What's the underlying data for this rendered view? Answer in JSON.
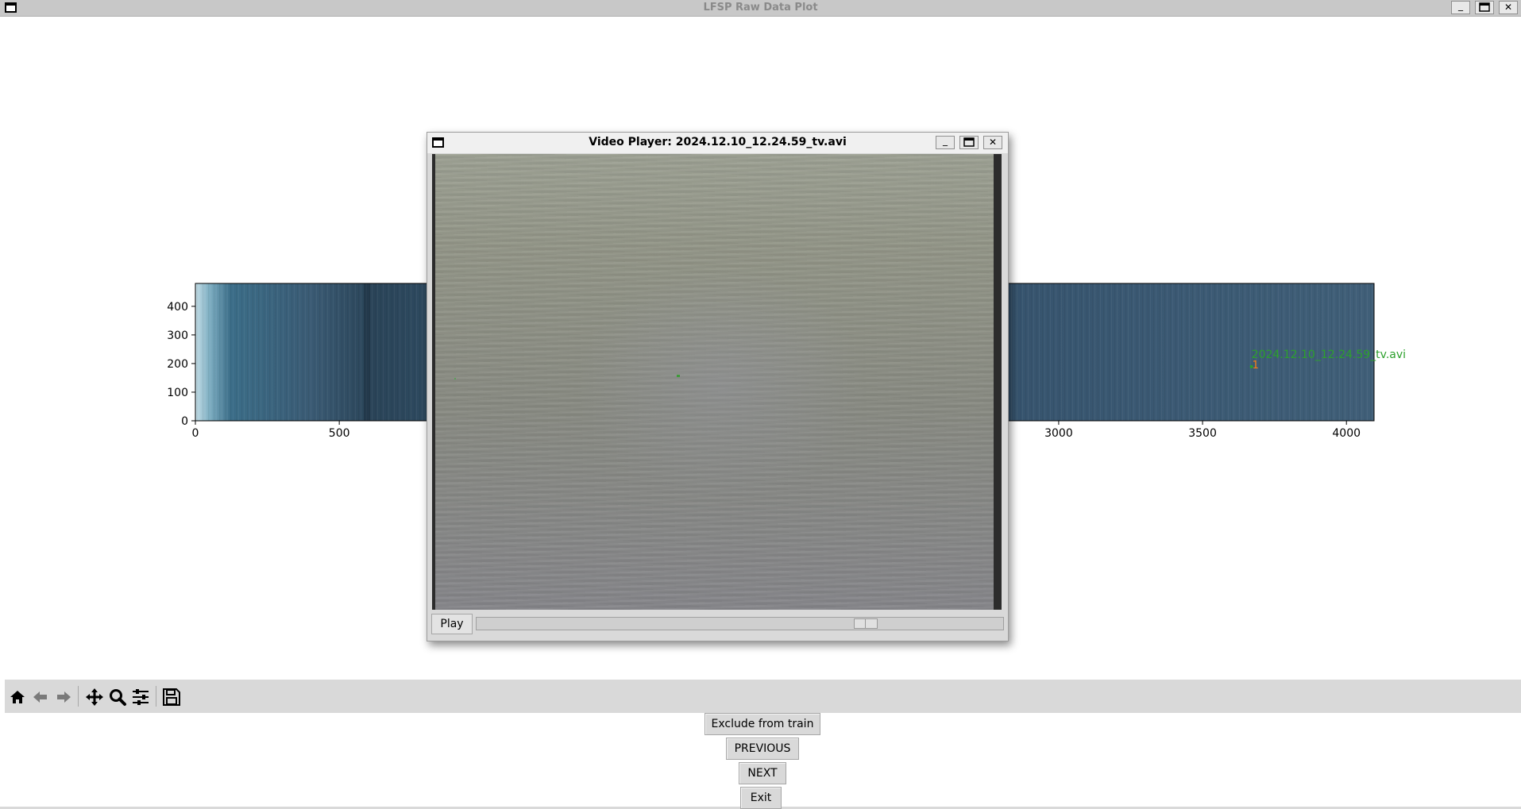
{
  "main_window": {
    "title": "LFSP Raw Data Plot",
    "minimize": "_",
    "close": "✕"
  },
  "plot": {
    "x_ticks": [
      "0",
      "500",
      "3000",
      "3500",
      "4000"
    ],
    "y_ticks": [
      "0",
      "100",
      "200",
      "300",
      "400"
    ],
    "annotation_label": "2024.12.10_12.24.59_tv.avi",
    "annotation_marker": "1",
    "colors": {
      "annotation": "#2ca02c",
      "marker": "#ff7f0e"
    }
  },
  "chart_data": {
    "type": "heatmap",
    "x_ticks": [
      0,
      500,
      3000,
      3500,
      4000
    ],
    "y_ticks": [
      0,
      100,
      200,
      300,
      400
    ],
    "xlim": [
      0,
      4096
    ],
    "ylim": [
      0,
      480
    ],
    "annotations": [
      {
        "text": "2024.12.10_12.24.59_tv.avi",
        "x": 3670,
        "y": 200
      },
      {
        "text": "1",
        "x": 3670,
        "y": 200
      }
    ]
  },
  "toolbar": {
    "tools": [
      "home-icon",
      "back-icon",
      "forward-icon",
      "pan-icon",
      "zoom-icon",
      "configure-icon",
      "save-icon"
    ]
  },
  "actions": {
    "exclude_label": "Exclude from train",
    "previous_label": "PREVIOUS",
    "next_label": "NEXT",
    "exit_label": "Exit"
  },
  "video_player": {
    "title": "Video Player: 2024.12.10_12.24.59_tv.avi",
    "minimize": "_",
    "close": "✕",
    "play_label": "Play",
    "progress": 0.75
  }
}
